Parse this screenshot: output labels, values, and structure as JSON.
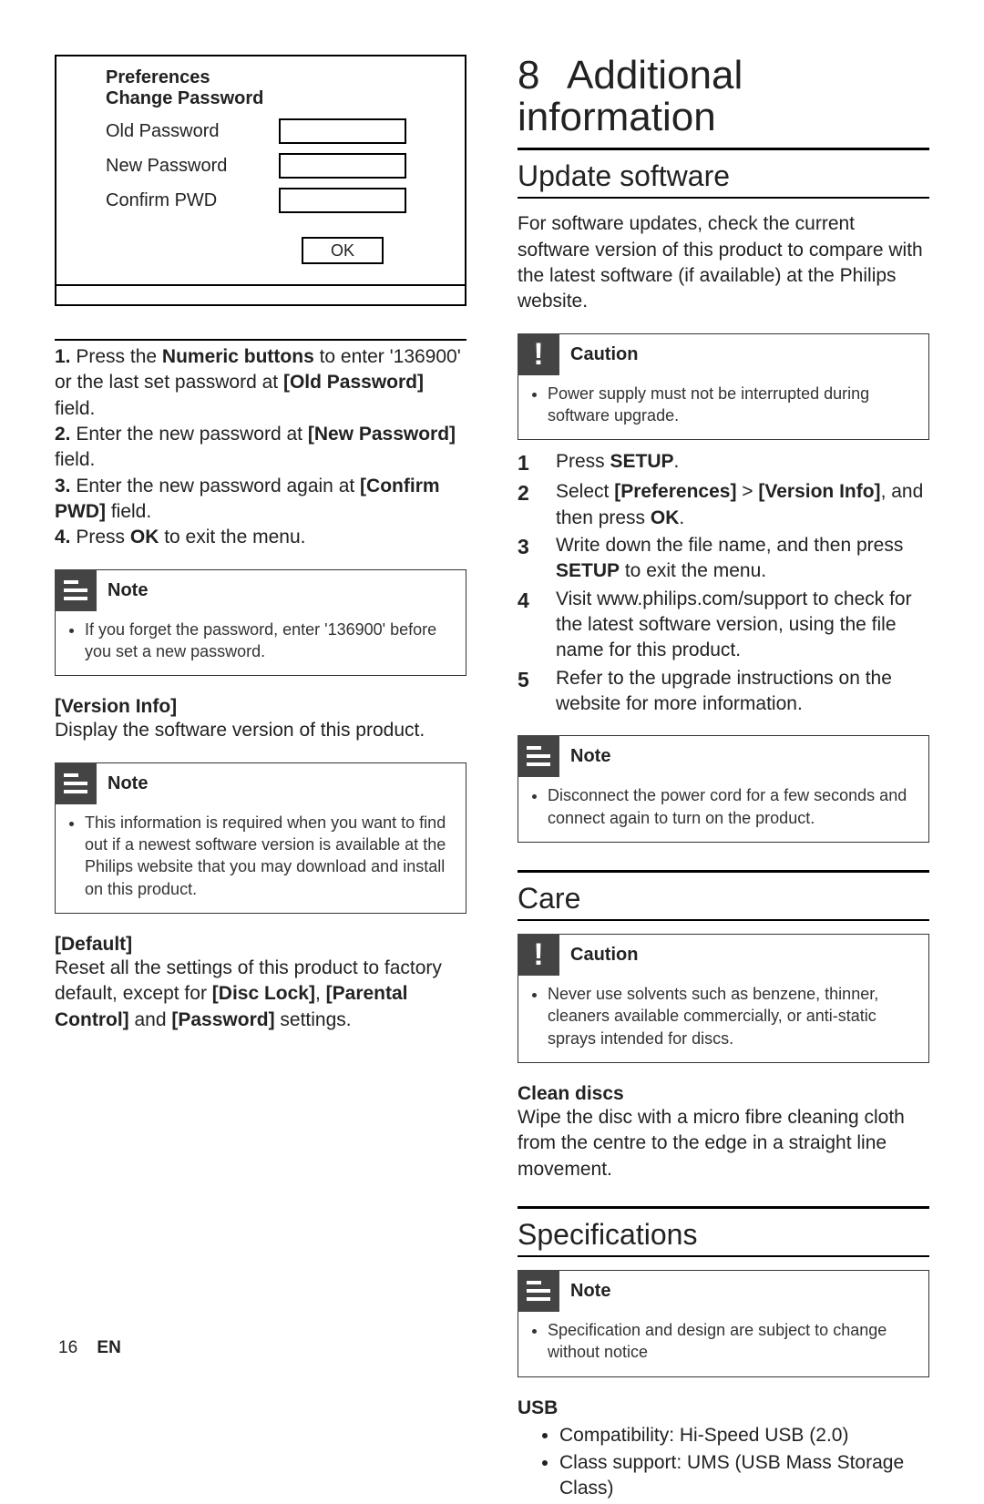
{
  "pref_box": {
    "title1": "Preferences",
    "title2": "Change Password",
    "row1": "Old Password",
    "row2": "New Password",
    "row3": "Confirm PWD",
    "ok": "OK"
  },
  "left": {
    "step1_a": "1.",
    "step1_b": " Press the ",
    "step1_c": "Numeric buttons",
    "step1_d": " to enter '136900' or the last set password at ",
    "step1_e": "[Old Password]",
    "step1_f": " field.",
    "step2_a": "2.",
    "step2_b": " Enter the new password at ",
    "step2_c": "[New Password]",
    "step2_d": " field.",
    "step3_a": "3.",
    "step3_b": " Enter the new password again at ",
    "step3_c": "[Confirm PWD]",
    "step3_d": " field.",
    "step4_a": "4.",
    "step4_b": " Press ",
    "step4_c": "OK",
    "step4_d": " to exit the menu.",
    "note1_title": "Note",
    "note1_body": "If you forget the password, enter '136900' before you set a new password.",
    "version_label": "[Version Info]",
    "version_text": "Display the software version of this product.",
    "note2_title": "Note",
    "note2_body": "This information is required when you want to find out if a newest software version is available at the Philips website that you may download and install on this product.",
    "default_label": "[Default]",
    "default_a": "Reset all the settings of this product to factory default, except for ",
    "default_b": "[Disc Lock]",
    "default_c": ", ",
    "default_d": "[Parental Control]",
    "default_e": " and ",
    "default_f": "[Password]",
    "default_g": " settings."
  },
  "right": {
    "chapter_num": "8",
    "chapter_title": "Additional information",
    "update_h": "Update software",
    "update_p": "For software updates, check the current software version of this product to compare with the latest software (if available) at the Philips website.",
    "caution1_title": "Caution",
    "caution1_body": "Power supply must not be interrupted during software upgrade.",
    "s1_a": "Press ",
    "s1_b": "SETUP",
    "s1_c": ".",
    "s2_a": "Select ",
    "s2_b": "[Preferences]",
    "s2_c": " > ",
    "s2_d": "[Version Info]",
    "s2_e": ", and then press ",
    "s2_f": "OK",
    "s2_g": ".",
    "s3_a": "Write down the file name, and then press ",
    "s3_b": "SETUP",
    "s3_c": " to exit the menu.",
    "s4": "Visit www.philips.com/support to check for the latest software version, using the file name for this product.",
    "s5": "Refer to the upgrade instructions on the website for more information.",
    "note3_title": "Note",
    "note3_body": "Disconnect the power cord for a few seconds and connect again to turn on the product.",
    "care_h": "Care",
    "caution2_title": "Caution",
    "caution2_body": "Never use solvents such as benzene, thinner, cleaners available commercially, or anti-static sprays intended for discs.",
    "clean_label": "Clean discs",
    "clean_text": "Wipe the disc with a micro fibre cleaning cloth from the centre to the edge in a straight line movement.",
    "spec_h": "Specifications",
    "note4_title": "Note",
    "note4_body": "Specification and design are subject to change without notice",
    "usb_label": "USB",
    "usb_b1": "Compatibility: Hi-Speed USB (2.0)",
    "usb_b2": "Class support: UMS (USB Mass Storage Class)"
  },
  "footer": {
    "page": "16",
    "lang": "EN"
  }
}
